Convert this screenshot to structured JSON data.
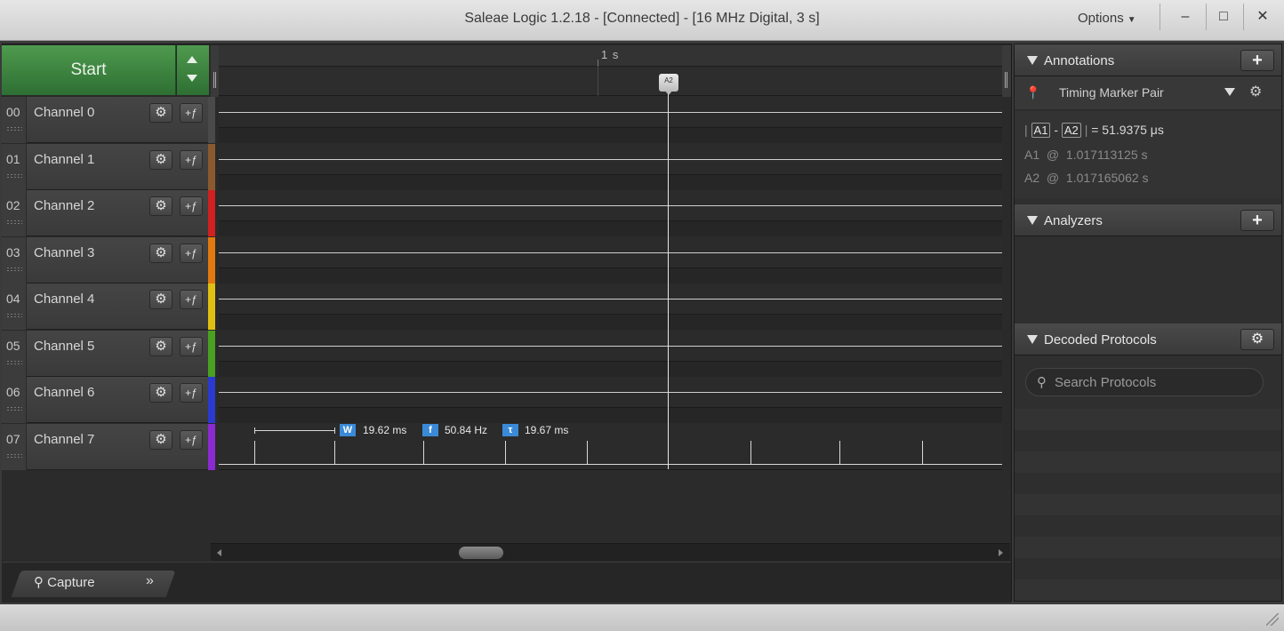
{
  "window": {
    "title": "Saleae Logic 1.2.18 - [Connected] - [16 MHz Digital, 3 s]",
    "options_label": "Options",
    "minimize": "–",
    "maximize": "□",
    "close": "✕"
  },
  "toolbar": {
    "start_label": "Start"
  },
  "timeline": {
    "label": "1 s",
    "marker_label": "A2"
  },
  "channels": [
    {
      "num": "00",
      "name": "Channel 0",
      "color": "#4a4a4a"
    },
    {
      "num": "01",
      "name": "Channel 1",
      "color": "#8a5a2e"
    },
    {
      "num": "02",
      "name": "Channel 2",
      "color": "#d02020"
    },
    {
      "num": "03",
      "name": "Channel 3",
      "color": "#e07a10"
    },
    {
      "num": "04",
      "name": "Channel 4",
      "color": "#e0c010"
    },
    {
      "num": "05",
      "name": "Channel 5",
      "color": "#4aa020"
    },
    {
      "num": "06",
      "name": "Channel 6",
      "color": "#2a3ad0"
    },
    {
      "num": "07",
      "name": "Channel 7",
      "color": "#8a2ad0"
    }
  ],
  "channel_buttons": {
    "gear": "⚙",
    "trigger": "+ƒ"
  },
  "measurements": {
    "width_icon": "W",
    "width_value": "19.62 ms",
    "freq_icon": "f",
    "freq_value": "50.84 Hz",
    "period_icon": "τ",
    "period_value": "19.67 ms"
  },
  "bottom_tabs": {
    "capture": "Capture",
    "more": "»"
  },
  "annotations": {
    "title": "Annotations",
    "add": "+",
    "timing_marker": "Timing Marker Pair",
    "a1": "A1",
    "a2": "A2",
    "delta_sep": "-",
    "delta_value": "= 51.9375 μs",
    "at": "@",
    "a1_time": "1.017113125 s",
    "a2_time": "1.017165062 s"
  },
  "analyzers": {
    "title": "Analyzers",
    "add": "+"
  },
  "decoded": {
    "title": "Decoded Protocols",
    "gear": "⚙",
    "search_placeholder": "Search Protocols"
  }
}
